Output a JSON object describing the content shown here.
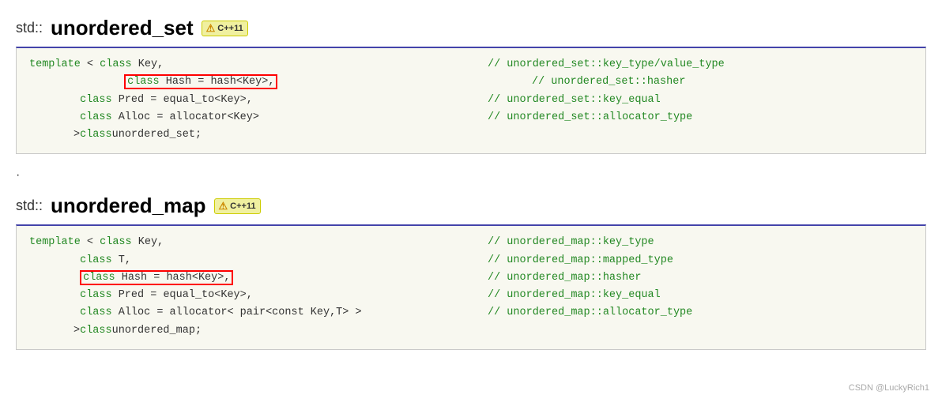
{
  "sections": [
    {
      "id": "unordered_set",
      "prefix": "std::",
      "title": "unordered_set",
      "badge": "C++11",
      "code_lines": [
        {
          "code": "template < class Key,",
          "comment": "// unordered_set::key_type/value_type",
          "highlight": false,
          "indent": 0
        },
        {
          "code": "class Hash = hash<Key>,",
          "comment": "// unordered_set::hasher",
          "highlight": true,
          "indent": 1
        },
        {
          "code": "class Pred = equal_to<Key>,",
          "comment": "// unordered_set::key_equal",
          "highlight": false,
          "indent": 1
        },
        {
          "code": "class Alloc = allocator<Key>",
          "comment": "// unordered_set::allocator_type",
          "highlight": false,
          "indent": 1
        },
        {
          "code": "> class unordered_set;",
          "comment": "",
          "highlight": false,
          "indent": 1
        }
      ]
    },
    {
      "id": "unordered_map",
      "prefix": "std::",
      "title": "unordered_map",
      "badge": "C++11",
      "code_lines": [
        {
          "code": "template < class Key,",
          "comment": "// unordered_map::key_type",
          "highlight": false,
          "indent": 0
        },
        {
          "code": "class T,",
          "comment": "// unordered_map::mapped_type",
          "highlight": false,
          "indent": 1
        },
        {
          "code": "class Hash = hash<Key>,",
          "comment": "// unordered_map::hasher",
          "highlight": true,
          "indent": 1
        },
        {
          "code": "class Pred = equal_to<Key>,",
          "comment": "// unordered_map::key_equal",
          "highlight": false,
          "indent": 1
        },
        {
          "code": "class Alloc = allocator< pair<const Key,T> >",
          "comment": "// unordered_map::allocator_type",
          "highlight": false,
          "indent": 1
        },
        {
          "code": "> class unordered_map;",
          "comment": "",
          "highlight": false,
          "indent": 1
        }
      ]
    }
  ],
  "watermark": "CSDN @LuckyRich1"
}
